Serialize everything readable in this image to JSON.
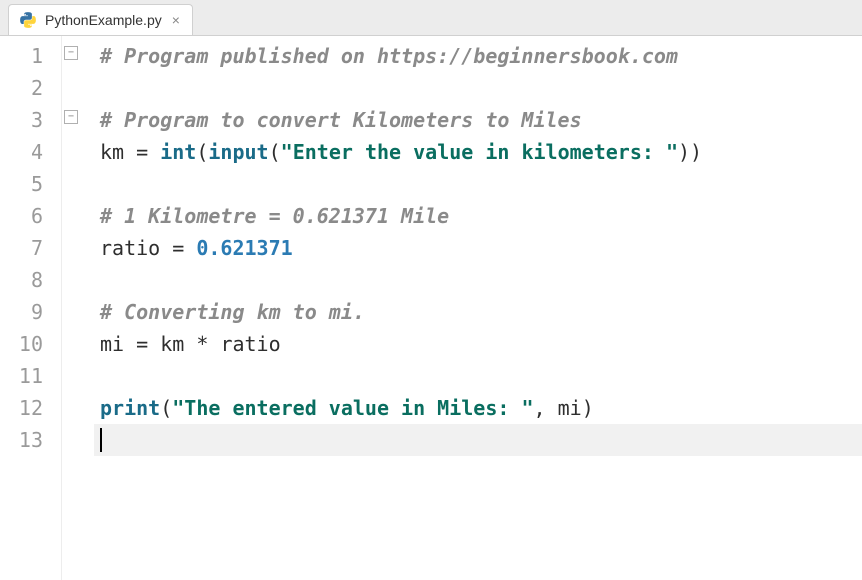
{
  "tab": {
    "filename": "PythonExample.py",
    "close_glyph": "×"
  },
  "gutter": {
    "lines": [
      "1",
      "2",
      "3",
      "4",
      "5",
      "6",
      "7",
      "8",
      "9",
      "10",
      "11",
      "12",
      "13"
    ]
  },
  "fold_markers": [
    {
      "line": 1
    },
    {
      "line": 3
    }
  ],
  "code": {
    "l1_comment": "# Program published on https://beginnersbook.com",
    "l3_comment": "# Program to convert Kilometers to Miles",
    "l4_ident": "km ",
    "l4_op": "= ",
    "l4_int": "int",
    "l4_p1": "(",
    "l4_input": "input",
    "l4_p2": "(",
    "l4_str": "\"Enter the value in kilometers: \"",
    "l4_p3": "))",
    "l6_comment": "# 1 Kilometre = 0.621371 Mile",
    "l7_ident": "ratio ",
    "l7_op": "= ",
    "l7_num": "0.621371",
    "l9_comment": "# Converting km to mi.",
    "l10_ident1": "mi ",
    "l10_op1": "= ",
    "l10_ident2": "km ",
    "l10_op2": "* ",
    "l10_ident3": "ratio",
    "l12_print": "print",
    "l12_p1": "(",
    "l12_str": "\"The entered value in Miles: \"",
    "l12_sep": ", ",
    "l12_arg": "mi",
    "l12_p2": ")"
  }
}
